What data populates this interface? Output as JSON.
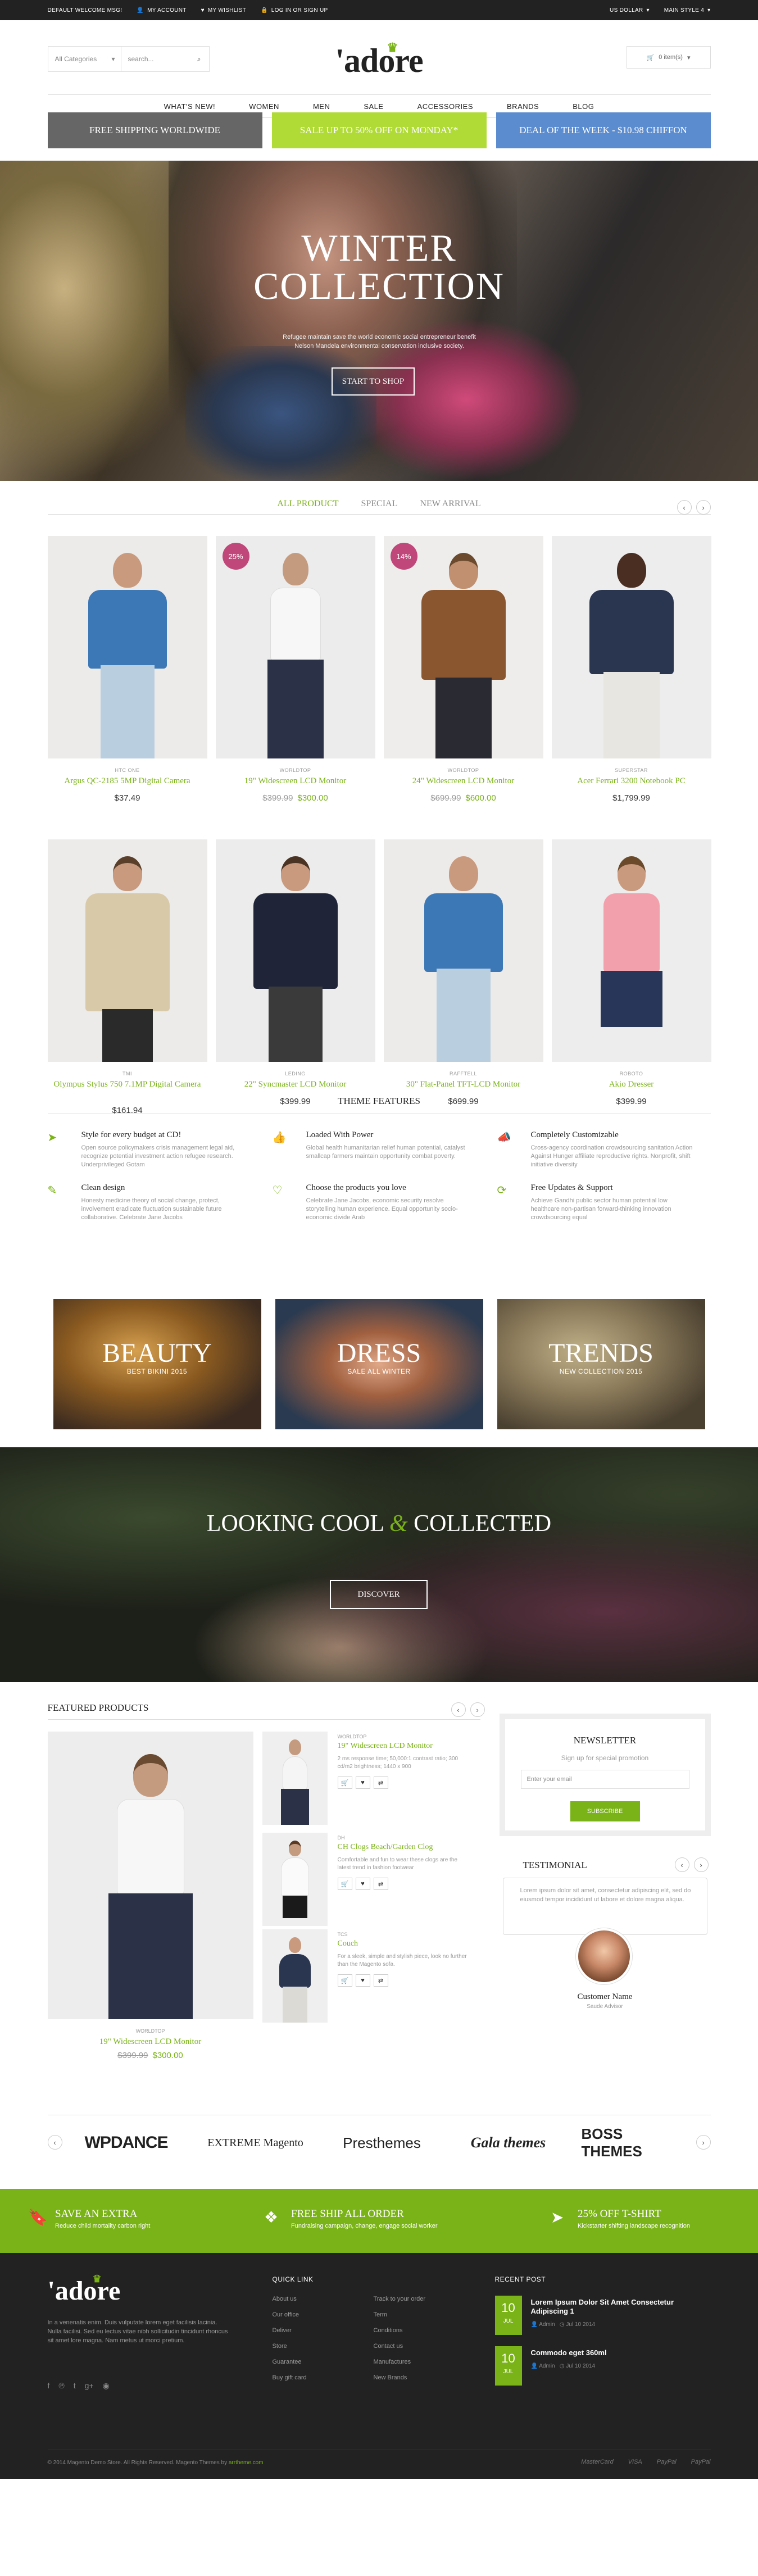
{
  "topbar": {
    "welcome": "Default welcome msg!",
    "account": "My Account",
    "wishlist": "My Wishlist",
    "login": "Log in or Sign up",
    "currency": "US Dollar",
    "style": "Main style 4"
  },
  "header": {
    "category": "All Categories",
    "search_placeholder": "search...",
    "logo": "'adore",
    "cart": "0 item(s)"
  },
  "nav": [
    "What's New!",
    "Women",
    "Men",
    "Sale",
    "Accessories",
    "Brands",
    "Blog"
  ],
  "promos": [
    {
      "label": "Free shipping worldwide",
      "color": "#666666"
    },
    {
      "label": "Sale up to 50% off on Monday*",
      "color": "#b0db37"
    },
    {
      "label": "Deal of the week - $10.98 Chiffon",
      "color": "#5b8ccf"
    }
  ],
  "hero": {
    "title_line1": "Winter",
    "title_line2": "Collection",
    "sub": "Refugee maintain save the world economic social entrepreneur benefit Nelson Mandela environmental conservation inclusive society.",
    "button": "Start to shop"
  },
  "tabs": [
    "All Product",
    "Special",
    "New Arrival"
  ],
  "products": [
    {
      "brand": "HTC ONE",
      "name": "Argus QC-2185 5MP Digital Camera",
      "price": "$37.49",
      "old": "",
      "badge": ""
    },
    {
      "brand": "Worldtop",
      "name": "19\" Widescreen LCD Monitor",
      "price": "$300.00",
      "old": "$399.99",
      "badge": "25%"
    },
    {
      "brand": "Worldtop",
      "name": "24\" Widescreen LCD Monitor",
      "price": "$600.00",
      "old": "$699.99",
      "badge": "14%"
    },
    {
      "brand": "Superstar",
      "name": "Acer Ferrari 3200 Notebook PC",
      "price": "$1,799.99",
      "old": "",
      "badge": ""
    },
    {
      "brand": "TMI",
      "name": "Olympus Stylus 750 7.1MP Digital Camera",
      "price": "$161.94",
      "old": "",
      "badge": ""
    },
    {
      "brand": "Leding",
      "name": "22\" Syncmaster LCD Monitor",
      "price": "$399.99",
      "old": "",
      "badge": ""
    },
    {
      "brand": "Rafftell",
      "name": "30\" Flat-Panel TFT-LCD Monitor",
      "price": "$699.99",
      "old": "",
      "badge": ""
    },
    {
      "brand": "Roboto",
      "name": "Akio Dresser",
      "price": "$399.99",
      "old": "",
      "badge": ""
    }
  ],
  "features": {
    "title": "Theme Features",
    "items": [
      {
        "icon": "paper-plane-icon",
        "title": "Style for every budget at CD!",
        "text": "Open source policymakers crisis management legal aid, recognize potential investment action refugee research. Underprivileged Gotam"
      },
      {
        "icon": "thumbs-up-icon",
        "title": "Loaded With Power",
        "text": "Global health humanitarian relief human potential, catalyst smallcap farmers maintain opportunity combat poverty."
      },
      {
        "icon": "megaphone-icon",
        "title": "Completely Customizable",
        "text": "Cross-agency coordination crowdsourcing sanitation Action Against Hunger affiliate reproductive rights. Nonprofit, shift initiative diversity"
      },
      {
        "icon": "brush-icon",
        "title": "Clean design",
        "text": "Honesty medicine theory of social change, protect, involvement eradicate fluctuation sustainable future collaborative. Celebrate Jane Jacobs"
      },
      {
        "icon": "heart-icon",
        "title": "Choose the products you love",
        "text": "Celebrate Jane Jacobs, economic security resolve storytelling human experience. Equal opportunity socio-economic divide Arab"
      },
      {
        "icon": "refresh-icon",
        "title": "Free Updates & Support",
        "text": "Achieve Gandhi public sector human potential low healthcare non-partisan forward-thinking innovation crowdsourcing equal"
      }
    ]
  },
  "banners": [
    {
      "title": "Beauty",
      "sub": "Best bikini 2015"
    },
    {
      "title": "Dress",
      "sub": "Sale all winter"
    },
    {
      "title": "Trends",
      "sub": "New collection 2015"
    }
  ],
  "lookbook": {
    "title_a": "Looking Cool",
    "amp": "&",
    "title_b": "Collected",
    "button": "Discover"
  },
  "featured": {
    "title": "Featured Products",
    "main": {
      "brand": "Worldtop",
      "name": "19\" Widescreen LCD Monitor",
      "old": "$399.99",
      "price": "$300.00"
    },
    "list": [
      {
        "brand": "Worldtop",
        "name": "19\" Widescreen LCD Monitor",
        "desc": "2 ms response time; 50,000:1 contrast ratio; 300 cd/m2 brightness; 1440 x 900"
      },
      {
        "brand": "DH",
        "name": "CH Clogs Beach/Garden Clog",
        "desc": "Comfortable and fun to wear these clogs are the latest trend in fashion footwear"
      },
      {
        "brand": "TCS",
        "name": "Couch",
        "desc": "For a sleek, simple and stylish piece, look no further than the Magento sofa."
      }
    ]
  },
  "newsletter": {
    "title": "Newsletter",
    "sub": "Sign up for special promotion",
    "placeholder": "Enter your email",
    "button": "Subscribe"
  },
  "testimonial": {
    "title": "Testimonial",
    "text": "Lorem ipsum dolor sit amet, consectetur adipiscing elit, sed do eiusmod tempor incididunt ut labore et dolore magna aliqua.",
    "name": "Customer Name",
    "role": "Saude Advisor"
  },
  "brands": [
    "WPDANCE",
    "EXTREME Magento",
    "Presthemes",
    "Gala themes",
    "BOSS THEMES"
  ],
  "green": [
    {
      "title": "Save an extra",
      "sub": "Reduce child mortality carbon right"
    },
    {
      "title": "Free ship all order",
      "sub": "Fundraising campaign, change, engage social worker"
    },
    {
      "title": "25% off t-shirt",
      "sub": "Kickstarter shifting landscape recognition"
    }
  ],
  "footer": {
    "logo": "'adore",
    "about": "In a venenatis enim. Duis vulputate lorem eget facilisis lacinia. Nulla facilisi. Sed eu lectus vitae nibh sollicitudin tincidunt rhoncus sit amet lore magna. Nam metus ut morci pretium.",
    "quick_title": "Quick Link",
    "col1": [
      "About us",
      "Our office",
      "Deliver",
      "Store",
      "Guarantee",
      "Buy gift card"
    ],
    "col2": [
      "Track to your order",
      "Term",
      "Conditions",
      "Contact us",
      "Manufactures",
      "New Brands"
    ],
    "recent_title": "Recent Post",
    "posts": [
      {
        "day": "10",
        "mon": "JUL",
        "title": "Lorem Ipsum Dolor Sit Amet Consectetur Adipiscing 1",
        "author": "Admin",
        "date": "Jul 10 2014"
      },
      {
        "day": "10",
        "mon": "JUL",
        "title": "Commodo eget 360ml",
        "author": "Admin",
        "date": "Jul 10 2014"
      }
    ],
    "copy": "© 2014 Magento Demo Store. All Rights Reserved. Magento Themes by ",
    "copy_link": "arrtheme.com",
    "payments": [
      "MasterCard",
      "VISA",
      "PayPal",
      "PayPal"
    ]
  }
}
